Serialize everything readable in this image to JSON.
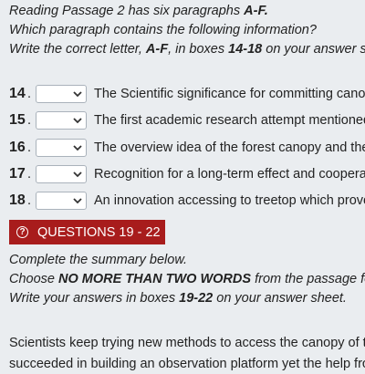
{
  "instructions": {
    "line1_pre": "Reading Passage 2 has six paragraphs ",
    "line1_bold": "A-F.",
    "line2": "Which paragraph contains the following information?",
    "line3_pre": "Write the correct letter, ",
    "line3_bold1": "A-F",
    "line3_mid": ", in boxes ",
    "line3_bold2": "14-18",
    "line3_post": " on your answer sh"
  },
  "questions": [
    {
      "num": "14",
      "dot": ".",
      "selected": "",
      "text": "The Scientific significance for committing canop"
    },
    {
      "num": "15",
      "dot": ".",
      "selected": "",
      "text": "The first academic research attempt mentioned"
    },
    {
      "num": "16",
      "dot": ".",
      "selected": "",
      "text": "The overview idea of the forest canopy and the"
    },
    {
      "num": "17",
      "dot": ".",
      "selected": "",
      "text": "Recognition for a long-term effect and cooperat"
    },
    {
      "num": "18",
      "dot": ".",
      "selected": "",
      "text": "An innovation accessing to treetop which prove"
    }
  ],
  "section_bar": {
    "icon": "question-circle-icon",
    "icon_glyph": "?",
    "label": "QUESTIONS 19 - 22",
    "color": "#a81c1c"
  },
  "summary_instructions": {
    "line1": "Complete the summary below.",
    "line2_pre": "Choose ",
    "line2_bold": "NO MORE THAN TWO WORDS",
    "line2_post": " from the passage for",
    "line3_pre": "Write your answers in boxes ",
    "line3_bold": "19-22",
    "line3_post": " on your answer sheet."
  },
  "passage": {
    "line1": "Scientists keep trying new methods to access the canopy of th",
    "line2": "succeeded in building an observation platform yet the help fro"
  }
}
